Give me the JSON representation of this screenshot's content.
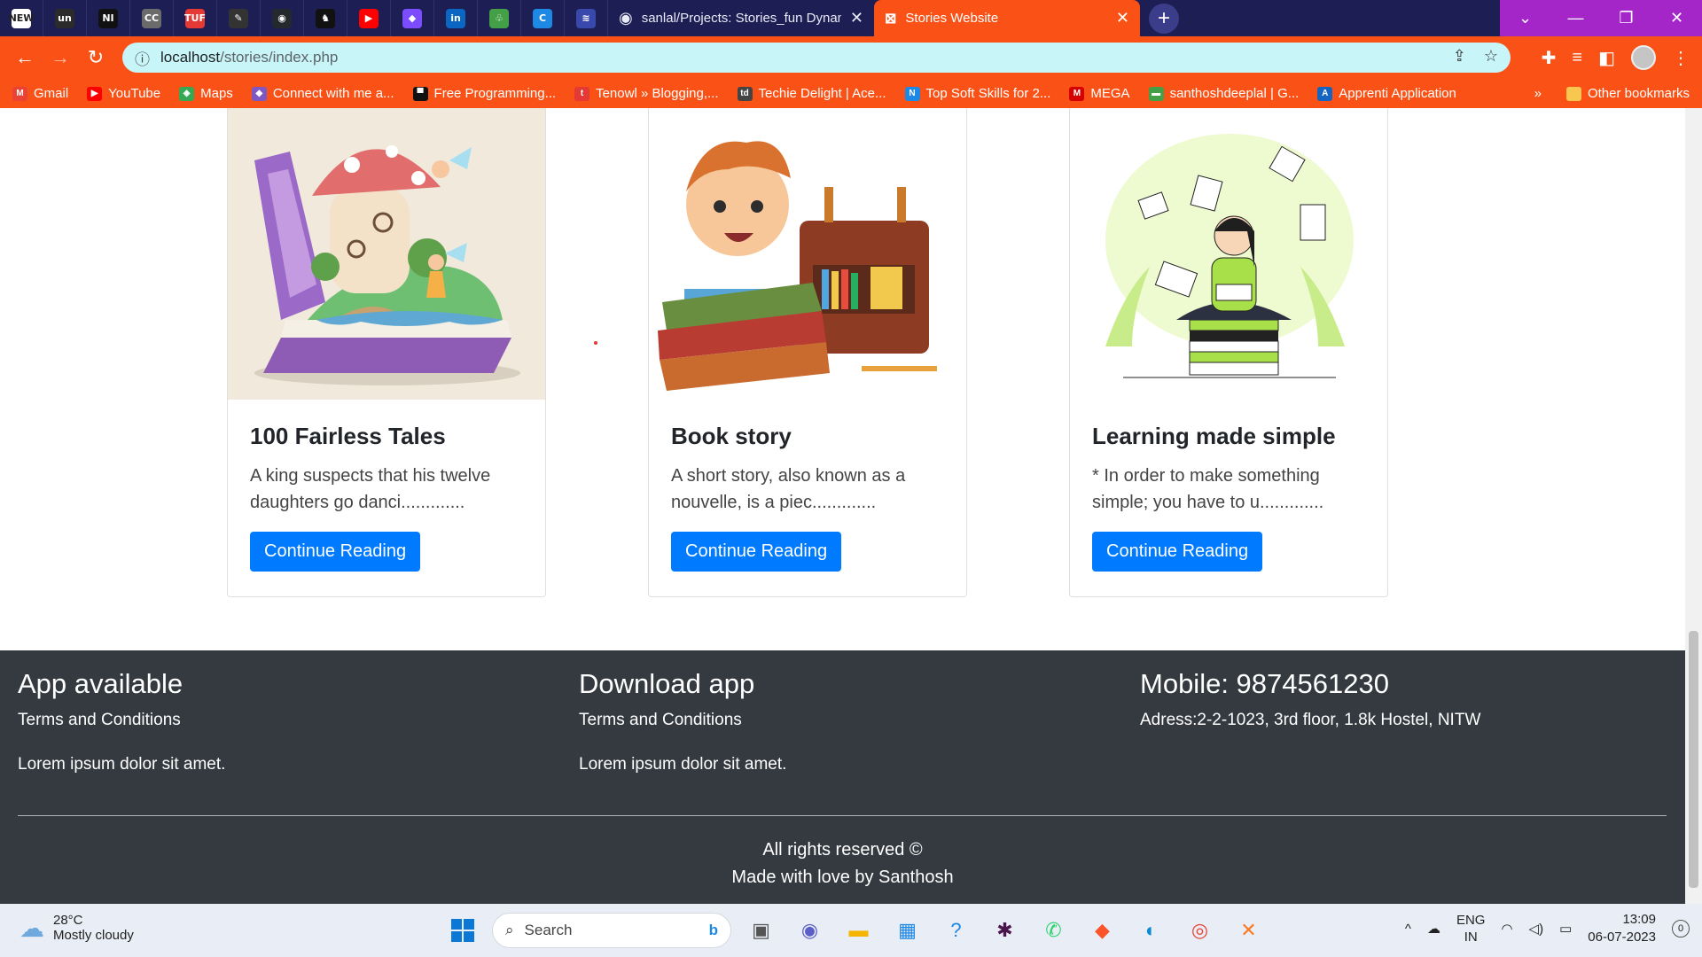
{
  "browser": {
    "pinned_tabs": [
      {
        "icon": "news-icon",
        "glyph": "NEW",
        "color": "#ffffff"
      },
      {
        "icon": "un-icon",
        "glyph": "un",
        "color": "#2b2b2b"
      },
      {
        "icon": "ni-icon",
        "glyph": "NI",
        "color": "#111111"
      },
      {
        "icon": "cc-icon",
        "glyph": "CC",
        "color": "#6b6b6b"
      },
      {
        "icon": "tuf-icon",
        "glyph": "TUF",
        "color": "#e53935"
      },
      {
        "icon": "tool-icon",
        "glyph": "✎",
        "color": "#333333"
      },
      {
        "icon": "github-icon",
        "glyph": "◉",
        "color": "#24292e"
      },
      {
        "icon": "chess-icon",
        "glyph": "♞",
        "color": "#111111"
      },
      {
        "icon": "youtube-icon",
        "glyph": "▶",
        "color": "#ff0000"
      },
      {
        "icon": "colorful-icon",
        "glyph": "◆",
        "color": "#7c4dff"
      },
      {
        "icon": "linkedin-icon",
        "glyph": "in",
        "color": "#0a66c2"
      },
      {
        "icon": "leaf-icon",
        "glyph": "♧",
        "color": "#43a047"
      },
      {
        "icon": "c-icon",
        "glyph": "C",
        "color": "#1e88e5"
      },
      {
        "icon": "cisco-icon",
        "glyph": "≋",
        "color": "#3949ab"
      }
    ],
    "tabs": [
      {
        "title": "sanlal/Projects: Stories_fun Dynam",
        "close": "✕"
      },
      {
        "title": "Stories Website",
        "close": "✕"
      }
    ],
    "new_tab": "+",
    "window_controls": {
      "dropdown": "⌄",
      "minimize": "—",
      "restore": "❐",
      "close": "✕"
    },
    "nav": {
      "back": "←",
      "forward": "→",
      "reload": "↻"
    },
    "address": {
      "host": "localhost",
      "path": "/stories/index.php",
      "info": "ⓘ"
    },
    "omni_actions": {
      "share": "⇪",
      "star": "☆"
    },
    "toolbar_actions": {
      "extensions": "✚",
      "media": "≡",
      "sidebar": "◧",
      "menu": "⋮"
    },
    "bookmarks": [
      {
        "label": "Gmail",
        "color": "#ea4335",
        "glyph": "M"
      },
      {
        "label": "YouTube",
        "color": "#ff0000",
        "glyph": "▶"
      },
      {
        "label": "Maps",
        "color": "#34a853",
        "glyph": "◈"
      },
      {
        "label": "Connect with me a...",
        "color": "#7e57c2",
        "glyph": "◆"
      },
      {
        "label": "Free Programming...",
        "color": "#111111",
        "glyph": "▀"
      },
      {
        "label": "Tenowl » Blogging,...",
        "color": "#e53935",
        "glyph": "t"
      },
      {
        "label": "Techie Delight | Ace...",
        "color": "#444444",
        "glyph": "td"
      },
      {
        "label": "Top Soft Skills for 2...",
        "color": "#1e88e5",
        "glyph": "N"
      },
      {
        "label": "MEGA",
        "color": "#d50000",
        "glyph": "M"
      },
      {
        "label": "santhoshdeeplal | G...",
        "color": "#43a047",
        "glyph": "▬"
      },
      {
        "label": "Apprenti Application",
        "color": "#1565c0",
        "glyph": "A"
      }
    ],
    "bookmarks_more": "»",
    "other_bookmarks": "Other bookmarks"
  },
  "cards": [
    {
      "title": "100 Fairless Tales",
      "text": "A king suspects that his twelve daughters go danci.............",
      "button": "Continue Reading"
    },
    {
      "title": "Book story",
      "text": "A short story, also known as a nouvelle, is a piec.............",
      "button": "Continue Reading"
    },
    {
      "title": "Learning made simple",
      "text": "* In order to make something simple; you have to u.............",
      "button": "Continue Reading"
    }
  ],
  "footer": {
    "columns": [
      {
        "heading": "App available",
        "lines": [
          "Terms and Conditions",
          "Lorem ipsum dolor sit amet."
        ]
      },
      {
        "heading": "Download app",
        "lines": [
          "Terms and Conditions",
          "Lorem ipsum dolor sit amet."
        ]
      },
      {
        "heading": "Mobile: 9874561230",
        "lines": [
          "Adress:2-2-1023, 3rd floor, 1.8k Hostel, NITW"
        ]
      }
    ],
    "rights": "All rights reserved ©",
    "made": "Made with love by Santhosh"
  },
  "taskbar": {
    "weather": {
      "temp": "28°C",
      "desc": "Mostly cloudy"
    },
    "search_placeholder": "Search",
    "apps": [
      {
        "name": "task-view-icon",
        "glyph": "▣",
        "color": "#555"
      },
      {
        "name": "teams-icon",
        "glyph": "◉",
        "color": "#5b5fc7"
      },
      {
        "name": "file-explorer-icon",
        "glyph": "▬",
        "color": "#f4b400"
      },
      {
        "name": "store-icon",
        "glyph": "▦",
        "color": "#1e88e5"
      },
      {
        "name": "help-icon",
        "glyph": "?",
        "color": "#1e88e5"
      },
      {
        "name": "slack-icon",
        "glyph": "✱",
        "color": "#4a154b"
      },
      {
        "name": "whatsapp-icon",
        "glyph": "✆",
        "color": "#25d366"
      },
      {
        "name": "brave-icon",
        "glyph": "◆",
        "color": "#fb542b"
      },
      {
        "name": "edge-icon",
        "glyph": "◐",
        "color": "#0c8ad4"
      },
      {
        "name": "chrome-icon",
        "glyph": "◎",
        "color": "#ea4335"
      },
      {
        "name": "xampp-icon",
        "glyph": "✕",
        "color": "#fb7a24"
      }
    ],
    "tray": {
      "chevron": "^",
      "cloud": "☁",
      "lang1": "ENG",
      "lang2": "IN",
      "wifi": "◠",
      "volume": "◁)",
      "battery": "▭",
      "time": "13:09",
      "date": "06-07-2023",
      "notif": "0"
    }
  }
}
